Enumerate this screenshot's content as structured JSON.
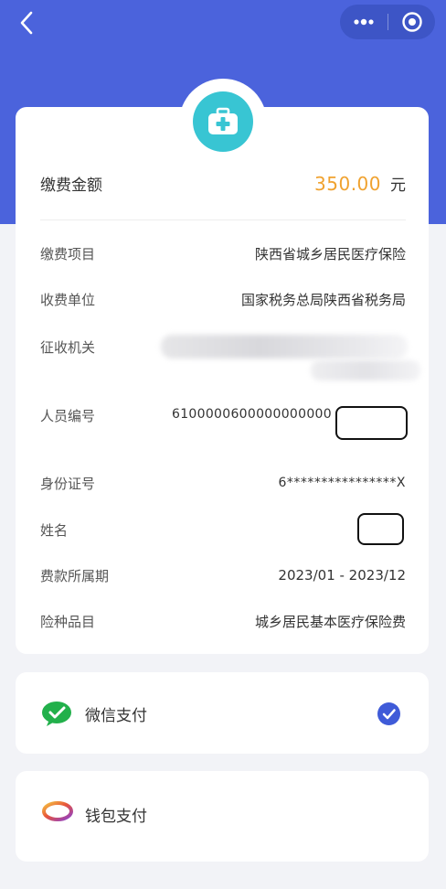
{
  "header": {
    "back_icon": "chevron-left-icon",
    "more_icon": "more-dots-icon",
    "close_icon": "target-close-icon"
  },
  "service_icon": "medical-kit-icon",
  "amount": {
    "label": "缴费金额",
    "value": "350.00",
    "unit": "元",
    "color": "#f0a22f"
  },
  "details": [
    {
      "label": "缴费项目",
      "value": "陕西省城乡居民医疗保险"
    },
    {
      "label": "收费单位",
      "value": "国家税务总局陕西省税务局"
    },
    {
      "label": "征收机关",
      "value": ""
    },
    {
      "label": "人员编号",
      "value": "6100000600000000000"
    },
    {
      "label": "身份证号",
      "value": "6****************X"
    },
    {
      "label": "姓名",
      "value": ""
    },
    {
      "label": "费款所属期",
      "value": "2023/01 - 2023/12"
    },
    {
      "label": "险种品目",
      "value": "城乡居民基本医疗保险费"
    }
  ],
  "payment_methods": [
    {
      "label": "微信支付",
      "icon": "wechat-pay-icon",
      "selected": true
    },
    {
      "label": "钱包支付",
      "icon": "wallet-ring-icon",
      "selected": false
    }
  ],
  "colors": {
    "header_bg": "#4b63dc",
    "accent_check": "#3f5bd8",
    "service_icon_bg": "#38c5d3"
  }
}
